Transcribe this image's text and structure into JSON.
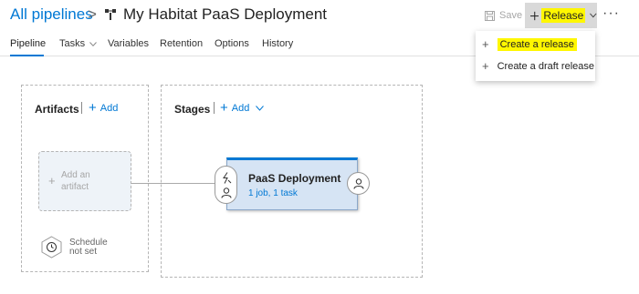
{
  "header": {
    "breadcrumb": "All pipelines",
    "separator": ">",
    "title": "My Habitat PaaS Deployment",
    "save_label": "Save",
    "release_label": "Release",
    "more": "···"
  },
  "tabs": [
    {
      "label": "Pipeline"
    },
    {
      "label": "Tasks"
    },
    {
      "label": "Variables"
    },
    {
      "label": "Retention"
    },
    {
      "label": "Options"
    },
    {
      "label": "History"
    }
  ],
  "release_menu": {
    "items": [
      {
        "label": "Create a release"
      },
      {
        "label": "Create a draft release"
      }
    ]
  },
  "artifacts": {
    "title": "Artifacts",
    "add_label": "Add",
    "placeholder_line1": "Add an",
    "placeholder_line2": "artifact",
    "schedule_line1": "Schedule",
    "schedule_line2": "not set"
  },
  "stages": {
    "title": "Stages",
    "add_label": "Add",
    "items": [
      {
        "name": "PaaS Deployment",
        "summary": "1 job, 1 task"
      }
    ]
  },
  "colors": {
    "accent": "#0078d4",
    "highlight": "#fff700",
    "stage_bg": "#d6e4f4"
  },
  "icons": [
    "pipeline-icon",
    "save-icon",
    "plus-icon",
    "chevron-down-icon",
    "more-icon",
    "clock-icon",
    "lightning-icon",
    "person-icon"
  ]
}
